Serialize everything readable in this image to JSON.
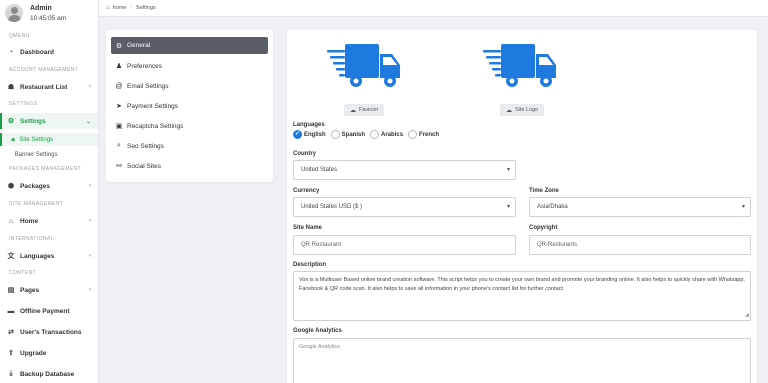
{
  "profile": {
    "name": "Admin",
    "time": "10:45:05 am"
  },
  "sidebar": {
    "sections": {
      "qmenu": "QMENU",
      "account": "ACCOUNT MANAGEMENT",
      "settings": "SETTINGS",
      "packages": "PACKAGES MANAGEMENT",
      "site": "SITE MANAGEMENT",
      "international": "INTERNATIONAL",
      "content": "CONTENT"
    },
    "items": {
      "dashboard": "Dashboard",
      "restaurant_list": "Restaurant List",
      "settings": "Settings",
      "site_settings": "Site Settings",
      "banner_settings": "Banner Settings",
      "packages": "Packages",
      "home": "Home",
      "languages": "Languages",
      "pages": "Pages",
      "offline_payment": "Offline Payment",
      "users_transactions": "User's Transactions",
      "upgrade": "Upgrade",
      "backup_database": "Backup Database"
    }
  },
  "breadcrumb": {
    "home": "home",
    "current": "Settings"
  },
  "settings_menu": [
    {
      "label": "General",
      "icon": "gear-icon"
    },
    {
      "label": "Preferences",
      "icon": "user-icon"
    },
    {
      "label": "Email Settings",
      "icon": "at-icon"
    },
    {
      "label": "Payment Settings",
      "icon": "send-icon"
    },
    {
      "label": "Recaptcha Settings",
      "icon": "recaptcha-icon"
    },
    {
      "label": "Seo Settings",
      "icon": "search-icon"
    },
    {
      "label": "Social Sites",
      "icon": "share-icon"
    }
  ],
  "form": {
    "favicon_button": "Favicon",
    "site_logo_button": "Site Logo",
    "languages_label": "Languages",
    "languages": [
      "English",
      "Spanish",
      "Arabics",
      "French"
    ],
    "selected_language": "English",
    "country_label": "Country",
    "country_value": "United States",
    "currency_label": "Currency",
    "currency_value": "United States USD ($ )",
    "timezone_label": "Time Zone",
    "timezone_value": "Asia/Dhaka",
    "site_name_label": "Site Name",
    "site_name_value": "QR Restaurant",
    "copyright_label": "Copyright",
    "copyright_value": "QR-Resturants",
    "description_label": "Description",
    "description_value": "Vox is a Multiuser Based online brand creation software. This script helps you to create your own brand and promote your branding online. It also helps to quickly share with Whatsapp, Facebook & QR code scan. It also helps to save all information in your phone's contact list for further contact",
    "analytics_label": "Google Analytics",
    "analytics_placeholder": "Google Analytics"
  },
  "colors": {
    "accent": "#1a9d4a",
    "truck": "#1f7ae0",
    "active_menu": "#585d66"
  }
}
